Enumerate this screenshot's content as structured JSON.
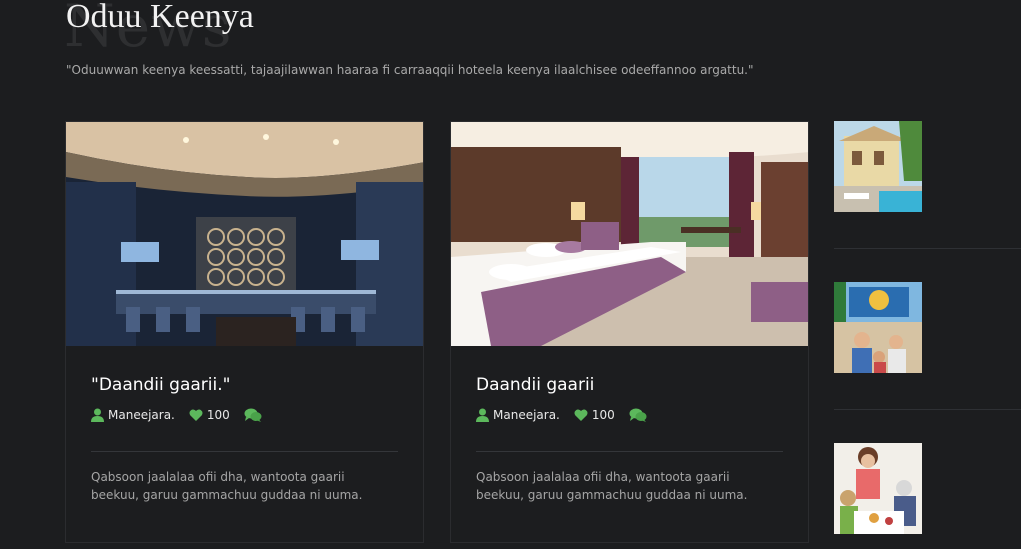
{
  "section": {
    "background_word": "News",
    "title": "Oduu Keenya",
    "subtitle": "\"Oduuwwan keenya keessatti, tajaajilawwan haaraa fi carraaqqii hoteela keenya ilaalchisee odeeffannoo argattu.\""
  },
  "colors": {
    "background": "#1c1d1f",
    "accent_green": "#5cb85c",
    "text_muted": "#a5a5a5"
  },
  "cards": [
    {
      "image": "hotel-bar-lounge-photo",
      "title": "\"Daandii gaarii.\"",
      "author": "Maneejara.",
      "likes": "100",
      "excerpt": "Qabsoon jaalalaa ofii dha, wantoota gaarii beekuu, garuu gammachuu guddaa ni uuma."
    },
    {
      "image": "hotel-bedroom-photo",
      "title": "Daandii gaarii",
      "author": "Maneejara.",
      "likes": "100",
      "excerpt": "Qabsoon jaalalaa ofii dha, wantoota gaarii beekuu, garuu gammachuu guddaa ni uuma."
    }
  ],
  "sidebar": {
    "thumbnails": [
      "resort-pool-photo",
      "beach-crowd-photo",
      "family-dinner-photo"
    ]
  },
  "icons": {
    "author": "user-icon",
    "likes": "heart-icon",
    "comments": "comments-icon"
  }
}
